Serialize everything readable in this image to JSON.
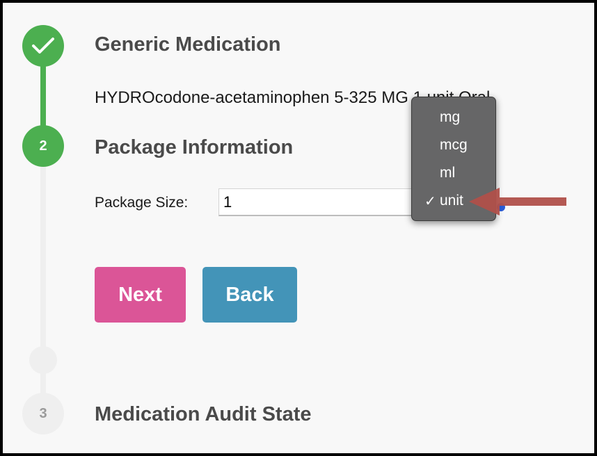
{
  "steps": [
    {
      "number": "",
      "status": "complete",
      "title": "Generic Medication"
    },
    {
      "number": "2",
      "status": "active",
      "title": "Package Information"
    },
    {
      "number": "3",
      "status": "pending",
      "title": "Medication Audit State"
    }
  ],
  "generic_medication": {
    "text": "HYDROcodone-acetaminophen 5-325 MG 1 unit Oral"
  },
  "package": {
    "size_label": "Package Size:",
    "size_value": "1"
  },
  "unit_menu": {
    "options": [
      "mg",
      "mcg",
      "ml",
      "unit"
    ],
    "selected": "unit",
    "check_glyph": "✓"
  },
  "buttons": {
    "next_label": "Next",
    "back_label": "Back"
  },
  "colors": {
    "complete": "#4caf50",
    "next": "#db5597",
    "back": "#4394b8",
    "arrow": "#b0504a"
  }
}
